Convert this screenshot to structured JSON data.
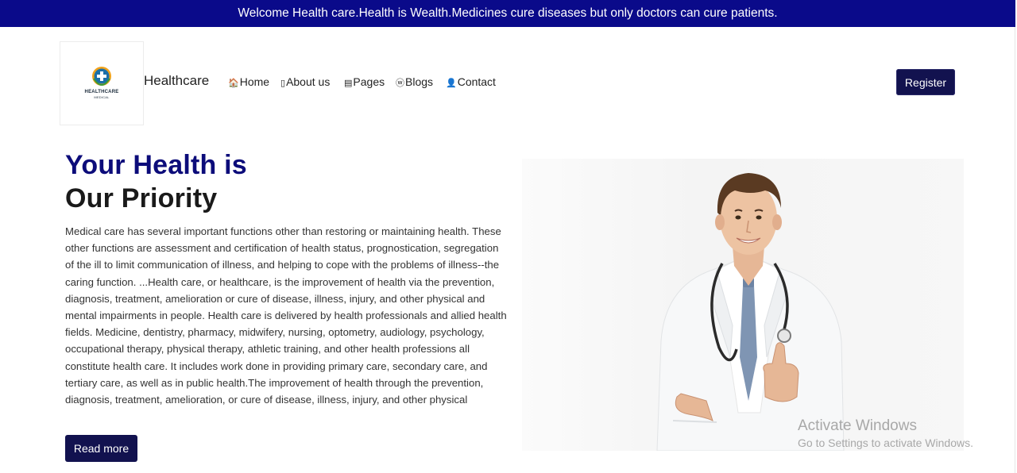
{
  "announcement": "Welcome Health care.Health is Wealth.Medicines cure diseases but only doctors can cure patients.",
  "logo": {
    "text": "HEALTHCARE",
    "subtext": "MEDICAL"
  },
  "brand": "Healthcare",
  "nav": [
    {
      "label": "Home",
      "icon": "home-icon",
      "glyph": "🏠"
    },
    {
      "label": "About us",
      "icon": "about-icon",
      "glyph": "▯"
    },
    {
      "label": "Pages",
      "icon": "pages-icon",
      "glyph": "▤"
    },
    {
      "label": "Blogs",
      "icon": "blogs-icon",
      "glyph": "ⓦ"
    },
    {
      "label": "Contact",
      "icon": "contact-icon",
      "glyph": "👤"
    }
  ],
  "register_label": "Register",
  "hero": {
    "title_line1": "Your Health is",
    "title_line2": "Our Priority",
    "body": "Medical care has several important functions other than restoring or maintaining health. These other functions are assessment and certification of health status, prognostication, segregation of the ill to limit communication of illness, and helping to cope with the problems of illness--the caring function. ...Health care, or healthcare, is the improvement of health via the prevention, diagnosis, treatment, amelioration or cure of disease, illness, injury, and other physical and mental impairments in people. Health care is delivered by health professionals and allied health fields. Medicine, dentistry, pharmacy, midwifery, nursing, optometry, audiology, psychology, occupational therapy, physical therapy, athletic training, and other health professions all constitute health care. It includes work done in providing primary care, secondary care, and tertiary care, as well as in public health.The improvement of health through the prevention, diagnosis, treatment, amelioration, or cure of disease, illness, injury, and other physical",
    "read_more_label": "Read more"
  },
  "watermark": {
    "line1": "Activate Windows",
    "line2": "Go to Settings to activate Windows."
  },
  "colors": {
    "topbar": "#0a0a8a",
    "button": "#12124f",
    "title_accent": "#0c0c7a"
  }
}
